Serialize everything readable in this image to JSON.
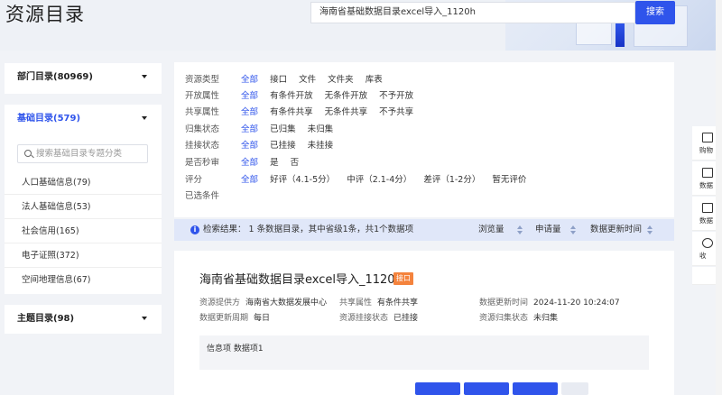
{
  "header": {
    "title": "资源目录",
    "search_value": "海南省基础数据目录excel导入_1120h",
    "search_button": "搜索"
  },
  "sidebar": {
    "dept": {
      "label": "部门目录(80969)"
    },
    "basic": {
      "label": "基础目录(579)",
      "search_placeholder": "搜索基础目录专题分类",
      "items": [
        "人口基础信息(79)",
        "法人基础信息(53)",
        "社会信用(165)",
        "电子证照(372)",
        "空间地理信息(67)"
      ]
    },
    "topic": {
      "label": "主题目录(98)"
    }
  },
  "filters": {
    "rows": [
      {
        "label": "资源类型",
        "options": [
          "全部",
          "接口",
          "文件",
          "文件夹",
          "库表"
        ]
      },
      {
        "label": "开放属性",
        "options": [
          "全部",
          "有条件开放",
          "无条件开放",
          "不予开放"
        ]
      },
      {
        "label": "共享属性",
        "options": [
          "全部",
          "有条件共享",
          "无条件共享",
          "不予共享"
        ]
      },
      {
        "label": "归集状态",
        "options": [
          "全部",
          "已归集",
          "未归集"
        ]
      },
      {
        "label": "挂接状态",
        "options": [
          "全部",
          "已挂接",
          "未挂接"
        ]
      },
      {
        "label": "是否秒审",
        "options": [
          "全部",
          "是",
          "否"
        ]
      },
      {
        "label": "评分",
        "options": [
          "全部",
          "好评（4.1-5分）",
          "中评（2.1-4分）",
          "差评（1-2分）",
          "暂无评价"
        ]
      }
    ],
    "selected_label": "已选条件"
  },
  "result_bar": {
    "text": "检索结果： 1 条数据目录，其中省级1条，共1个数据项",
    "sort_views": "浏览量",
    "sort_apply": "申请量",
    "sort_updated": "数据更新时间"
  },
  "result": {
    "title": "海南省基础数据目录excel导入_1120h",
    "tag": "接口",
    "provider_k": "资源提供方",
    "provider_v": "海南省大数据发展中心",
    "share_k": "共享属性",
    "share_v": "有条件共享",
    "updated_k": "数据更新时间",
    "updated_v": "2024-11-20 10:24:07",
    "cycle_k": "数据更新周期",
    "cycle_v": "每日",
    "mount_k": "资源挂接状态",
    "mount_v": "已挂接",
    "collect_k": "资源归集状态",
    "collect_v": "未归集",
    "detail": "信息项  数据项1"
  },
  "right_tools": [
    "购物",
    "数据",
    "数据",
    "收"
  ],
  "colors": {
    "primary": "#2f54eb",
    "tag": "#f4833d",
    "result_bar": "#e0e7f9"
  }
}
